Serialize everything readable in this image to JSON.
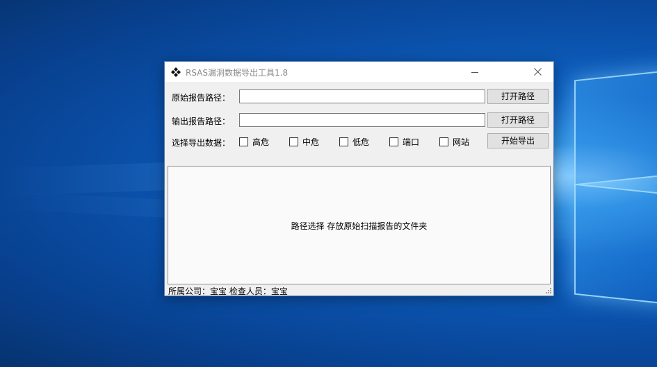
{
  "window": {
    "title": "RSAS漏洞数据导出工具1.8"
  },
  "form": {
    "source_label": "原始报告路径：",
    "source_value": "",
    "source_button": "打开路径",
    "output_label": "输出报告路径：",
    "output_value": "",
    "output_button": "打开路径",
    "select_label": "选择导出数据：",
    "options": [
      {
        "label": "高危",
        "checked": false
      },
      {
        "label": "中危",
        "checked": false
      },
      {
        "label": "低危",
        "checked": false
      },
      {
        "label": "端口",
        "checked": false
      },
      {
        "label": "网站",
        "checked": false
      }
    ],
    "export_button": "开始导出"
  },
  "panel": {
    "hint": "路径选择  存放原始扫描报告的文件夹"
  },
  "status": {
    "text": "所属公司：宝宝  检查人员：宝宝"
  },
  "colors": {
    "desktop_blue": "#0a4fa8",
    "window_bg": "#f0f0f0",
    "button_bg": "#e1e1e1"
  }
}
